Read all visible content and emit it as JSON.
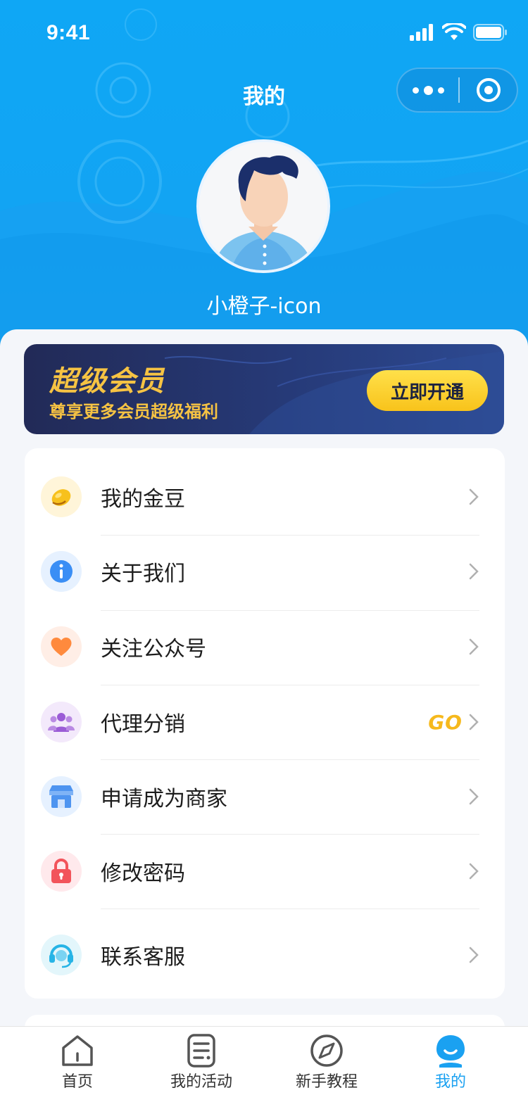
{
  "status_bar": {
    "time": "9:41"
  },
  "header": {
    "title": "我的"
  },
  "profile": {
    "username": "小橙子-icon"
  },
  "vip": {
    "title": "超级会员",
    "subtitle": "尊享更多会员超级福利",
    "button_label": "立即开通"
  },
  "menu": {
    "items": [
      {
        "label": "我的金豆",
        "icon": "gold-bean-icon"
      },
      {
        "label": "关于我们",
        "icon": "info-icon"
      },
      {
        "label": "关注公众号",
        "icon": "heart-icon"
      },
      {
        "label": "代理分销",
        "icon": "group-icon",
        "badge": "GO"
      },
      {
        "label": "申请成为商家",
        "icon": "store-icon"
      },
      {
        "label": "修改密码",
        "icon": "lock-icon"
      },
      {
        "label": "联系客服",
        "icon": "headset-icon"
      }
    ]
  },
  "tabbar": {
    "active_index": 3,
    "tabs": [
      {
        "label": "首页",
        "icon": "home-icon"
      },
      {
        "label": "我的活动",
        "icon": "document-icon"
      },
      {
        "label": "新手教程",
        "icon": "compass-icon"
      },
      {
        "label": "我的",
        "icon": "profile-icon"
      }
    ]
  },
  "colors": {
    "header_blue": "#12a4f3",
    "vip_gold": "#f6c343",
    "vip_navy": "#222a57",
    "active_tab": "#1aa1f1"
  }
}
